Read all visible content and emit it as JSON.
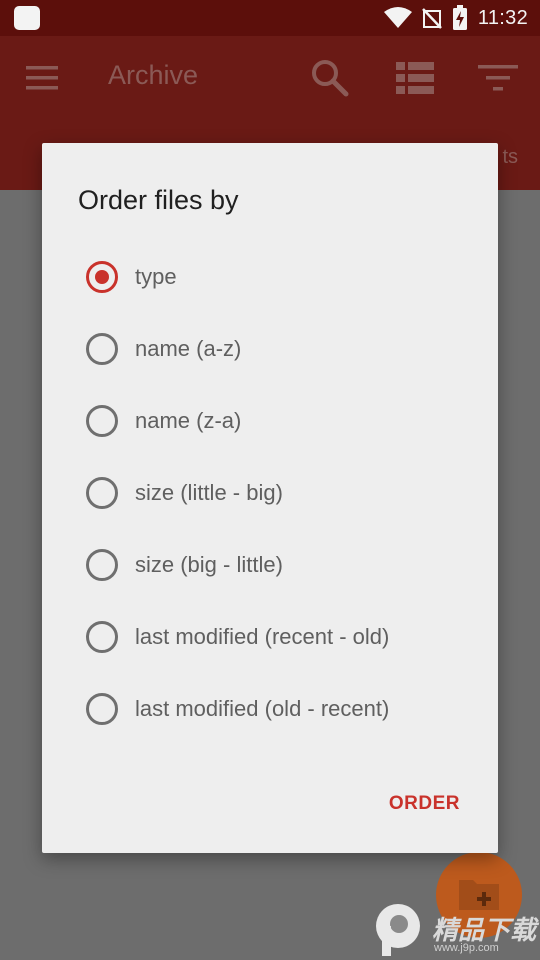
{
  "status_bar": {
    "time": "11:32",
    "icons": [
      "app-notification-icon",
      "wifi-icon",
      "signal-off-icon",
      "battery-charging-icon"
    ]
  },
  "app_bar": {
    "title": "Archive",
    "icons": [
      "menu-icon",
      "search-icon",
      "view-list-icon",
      "filter-icon"
    ],
    "tab_peek": "ts"
  },
  "dialog": {
    "title": "Order files by",
    "options": [
      {
        "label": "type",
        "checked": true
      },
      {
        "label": "name (a-z)",
        "checked": false
      },
      {
        "label": "name (z-a)",
        "checked": false
      },
      {
        "label": "size (little - big)",
        "checked": false
      },
      {
        "label": "size (big - little)",
        "checked": false
      },
      {
        "label": "last modified (recent - old)",
        "checked": false
      },
      {
        "label": "last modified (old - recent)",
        "checked": false
      }
    ],
    "button": "ORDER"
  },
  "fab": {
    "icon": "add-folder-icon"
  },
  "watermark": {
    "text": "精品下载",
    "url": "www.j9p.com"
  },
  "colors": {
    "status_bar": "#5c0f0b",
    "app_bar": "#6a1a15",
    "accent": "#c9322b",
    "fab": "#bd5a1d",
    "dialog_bg": "#eeeeee"
  }
}
